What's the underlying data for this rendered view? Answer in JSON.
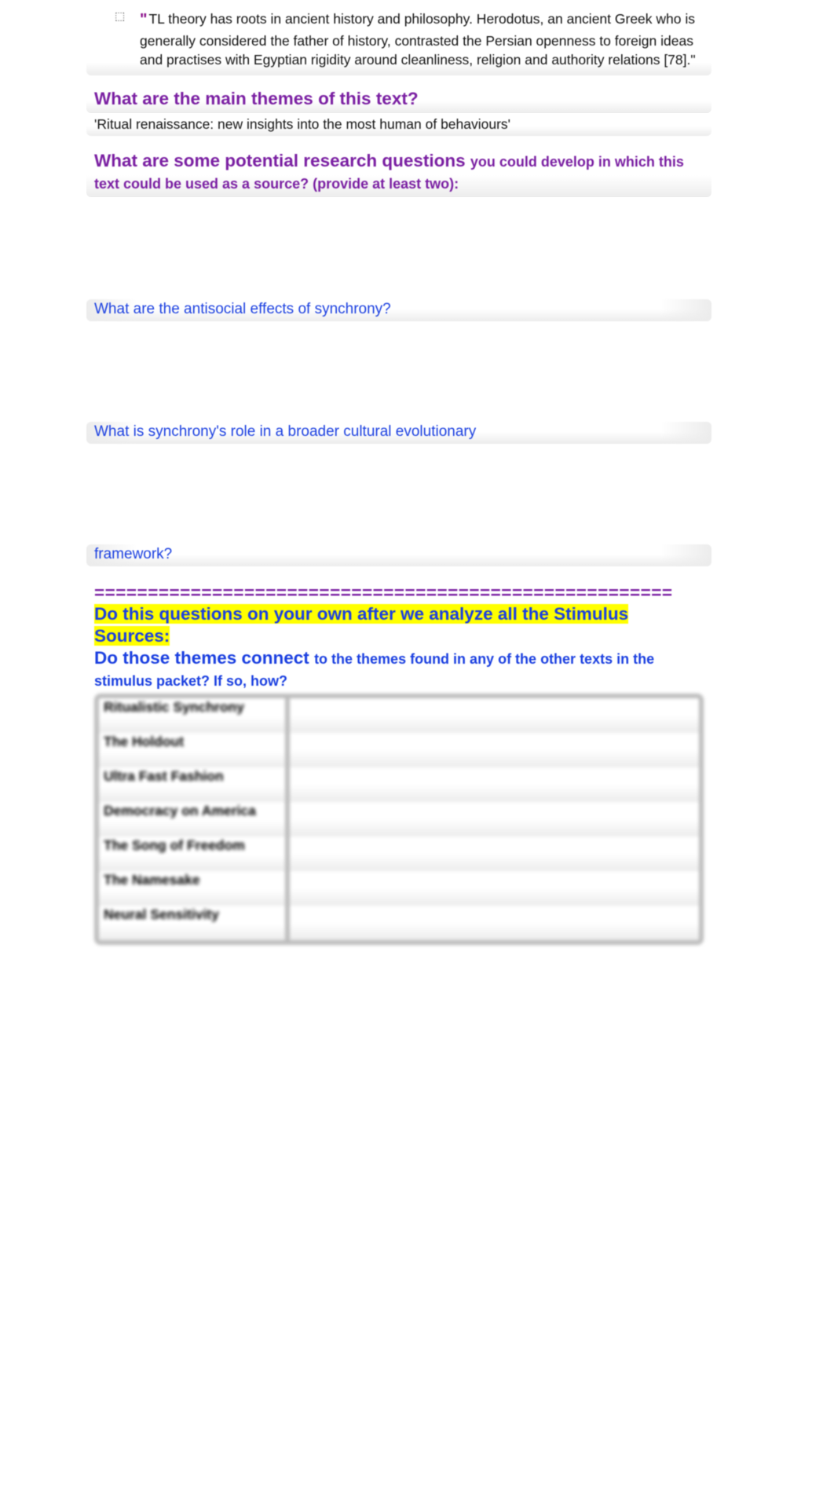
{
  "quote": {
    "bullet": "⬚",
    "open": "\"",
    "text": "TL theory has roots in ancient history and philosophy. Herodotus, an ancient Greek who is generally considered the father of history, contrasted the Persian openness to foreign ideas and practises with Egyptian rigidity around cleanliness, religion and authority relations [78].\""
  },
  "q1": {
    "heading": "What are the main themes of this text?",
    "answer": "'Ritual renaissance: new insights into the most human of behaviours'"
  },
  "q2": {
    "heading_a": "What are some potential research questions ",
    "heading_b": "you could develop in which this text could be used as a source? (provide at least two):",
    "ans1": "What are the antisocial effects of synchrony?",
    "ans2a": "What is synchrony's role in a broader cultural evolutionary",
    "ans2b": "framework?"
  },
  "divider": "======================================================",
  "instr": {
    "line1": "Do this questions on your own  after we analyze all the Stimulus Sources:",
    "line2a": "Do those themes connect ",
    "line2b": "to the themes found in any of the other texts in the stimulus packet? If so, how?"
  },
  "table": {
    "rows": [
      "Ritualistic Synchrony",
      "The Holdout",
      "Ultra Fast Fashion",
      "Democracy on America",
      "The Song of Freedom",
      "The Namesake",
      "Neural Sensitivity"
    ]
  }
}
